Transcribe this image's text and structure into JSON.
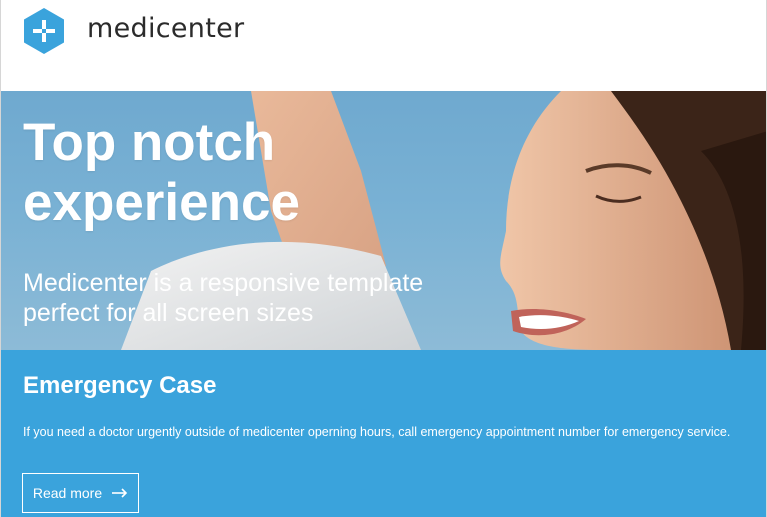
{
  "brand": {
    "name": "medicenter",
    "logo_icon": "plus-hexagon-icon",
    "accent_color": "#3aa3dc"
  },
  "hero": {
    "title": "Top notch experience",
    "subtitle": "Medicenter is a responsive template perfect for all screen sizes"
  },
  "emergency": {
    "title": "Emergency Case",
    "text": "If you need a doctor urgently outside of medicenter operning hours, call emergency appointment number for emergency service.",
    "button_label": "Read more",
    "button_icon": "arrow-right-icon"
  }
}
